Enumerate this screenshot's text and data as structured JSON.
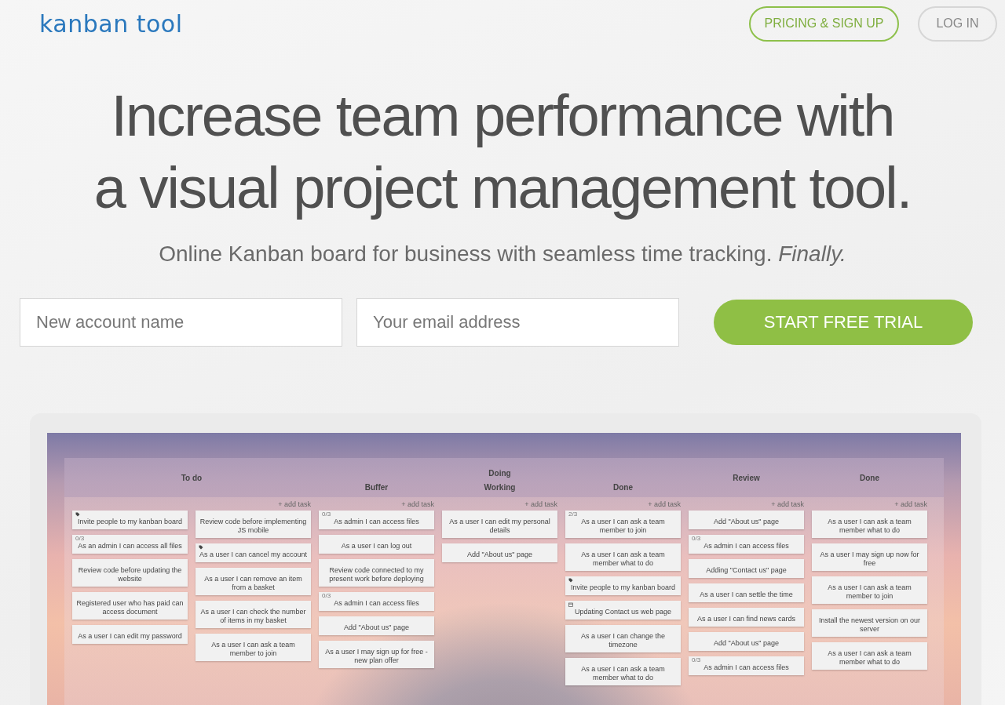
{
  "header": {
    "logo": "kanban tool",
    "buttons": [
      {
        "label": "PRICING & SIGN UP",
        "kind": "primary"
      },
      {
        "label": "LOG IN",
        "kind": "secondary"
      }
    ]
  },
  "hero": {
    "title_lines": [
      "Increase team performance with",
      "a visual project management tool."
    ],
    "subtitle": "Online Kanban board for business with seamless time tracking. *Finally.*"
  },
  "signup_form": {
    "fields": [
      {
        "placeholder": "New account name"
      },
      {
        "placeholder": "Your email address"
      }
    ],
    "submit": "START FREE TRIAL"
  },
  "board": {
    "columns": [
      {
        "kind": "column",
        "title": "To do",
        "add_task": "+ add task",
        "lanes": [
          [
            {
              "text": "Invite people to my kanban board",
              "kind": "tag"
            },
            {
              "text": "As an admin I can access all files",
              "counter": "0/3"
            },
            {
              "text": "Review code before updating the website"
            },
            {
              "text": "Registered user who has paid can access document"
            },
            {
              "text": "As a user I can edit my password"
            }
          ],
          [
            {
              "text": "Review code before implementing JS mobile"
            },
            {
              "text": "As a user I can cancel my account",
              "kind": "tag"
            },
            {
              "text": "As a user I can remove an item from a basket"
            },
            {
              "text": "As a user I can check the number of items in my basket"
            },
            {
              "text": "As a user I can ask a team member to join"
            }
          ]
        ]
      },
      {
        "kind": "group",
        "title": "Doing",
        "subcolumns": [
          {
            "title": "Buffer",
            "add_task": "+ add task",
            "lanes": [
              [
                {
                  "text": "As admin I can access files",
                  "counter": "0/3"
                },
                {
                  "text": "As a user I can log out"
                },
                {
                  "text": "Review code connected to my present work before deploying"
                },
                {
                  "text": "As admin I can access files",
                  "counter": "0/3"
                },
                {
                  "text": "Add \"About us\" page"
                },
                {
                  "text": "As a user I may sign up for free - new plan offer"
                }
              ]
            ]
          },
          {
            "title": "Working",
            "add_task": "+ add task",
            "lanes": [
              [
                {
                  "text": "As a user I can edit my personal details"
                },
                {
                  "text": "Add \"About us\" page"
                }
              ]
            ]
          },
          {
            "title": "Done",
            "add_task": "+ add task",
            "lanes": [
              [
                {
                  "text": "As a user I can ask a team member to join",
                  "counter": "2/3"
                },
                {
                  "text": "As a user I can ask a team member what to do"
                },
                {
                  "text": "Invite people to my kanban board",
                  "kind": "tag"
                },
                {
                  "text": "Updating Contact us web page",
                  "kind": "calendar"
                },
                {
                  "text": "As a user I can change the timezone"
                },
                {
                  "text": "As a user I can ask a team member what to do"
                }
              ]
            ]
          }
        ]
      },
      {
        "kind": "column",
        "title": "Review",
        "add_task": "+ add task",
        "lanes": [
          [
            {
              "text": "Add \"About us\" page"
            },
            {
              "text": "As admin I can access files",
              "counter": "0/3"
            },
            {
              "text": "Adding \"Contact us\" page"
            },
            {
              "text": "As a user I can settle the time"
            },
            {
              "text": "As a user I can find news cards"
            },
            {
              "text": "Add \"About us\" page"
            },
            {
              "text": "As admin I can access files",
              "counter": "0/3"
            }
          ]
        ]
      },
      {
        "kind": "column",
        "title": "Done",
        "add_task": "+ add task",
        "lanes": [
          [
            {
              "text": "As a user I can ask a team member what to do"
            },
            {
              "text": "As a user I may sign up now for free"
            },
            {
              "text": "As a user I can ask a team member to join"
            },
            {
              "text": "Install the newest version on our server"
            },
            {
              "text": "As a user I can ask a team member what to do"
            }
          ]
        ]
      }
    ]
  }
}
